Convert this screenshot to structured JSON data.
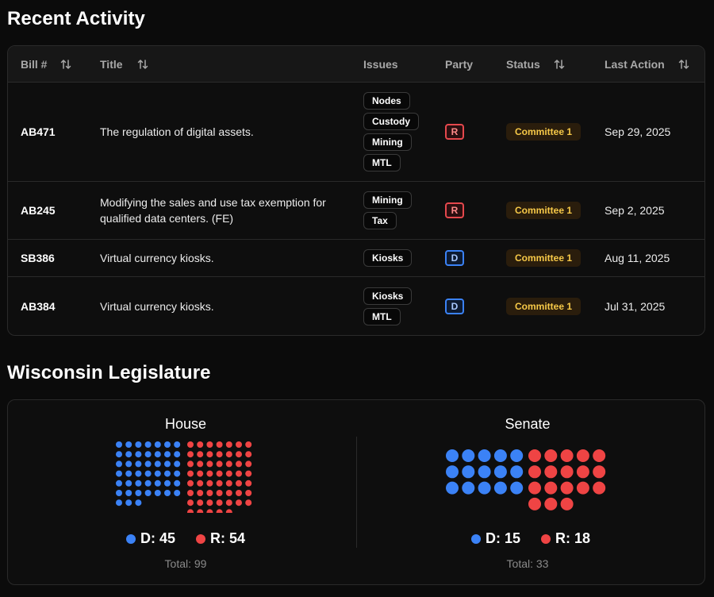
{
  "recent": {
    "heading": "Recent Activity",
    "columns": [
      {
        "label": "Bill #",
        "sortable": true
      },
      {
        "label": "Title",
        "sortable": true
      },
      {
        "label": "Issues",
        "sortable": false
      },
      {
        "label": "Party",
        "sortable": false
      },
      {
        "label": "Status",
        "sortable": true
      },
      {
        "label": "Last Action",
        "sortable": true
      }
    ],
    "rows": [
      {
        "bill": "AB471",
        "title": "The regulation of digital assets.",
        "issues": [
          "Nodes",
          "Custody",
          "Mining",
          "MTL"
        ],
        "party": "R",
        "status": "Committee 1",
        "date": "Sep 29, 2025"
      },
      {
        "bill": "AB245",
        "title": "Modifying the sales and use tax exemption for qualified data centers. (FE)",
        "issues": [
          "Mining",
          "Tax"
        ],
        "party": "R",
        "status": "Committee 1",
        "date": "Sep 2, 2025"
      },
      {
        "bill": "SB386",
        "title": "Virtual currency kiosks.",
        "issues": [
          "Kiosks"
        ],
        "party": "D",
        "status": "Committee 1",
        "date": "Aug 11, 2025"
      },
      {
        "bill": "AB384",
        "title": "Virtual currency kiosks.",
        "issues": [
          "Kiosks",
          "MTL"
        ],
        "party": "D",
        "status": "Committee 1",
        "date": "Jul 31, 2025"
      }
    ]
  },
  "legislature": {
    "heading": "Wisconsin Legislature",
    "house": {
      "title": "House",
      "d_label": "D: 45",
      "r_label": "R: 54",
      "d_seats": 45,
      "r_seats": 54,
      "total_label": "Total: 99"
    },
    "senate": {
      "title": "Senate",
      "d_label": "D: 15",
      "r_label": "R: 18",
      "d_seats": 15,
      "r_seats": 18,
      "total_label": "Total: 33"
    }
  },
  "colors": {
    "democrat": "#3b82f6",
    "republican": "#ef4444",
    "status_text": "#f7c948"
  },
  "icons": {
    "sort": "sort-arrows-icon"
  }
}
